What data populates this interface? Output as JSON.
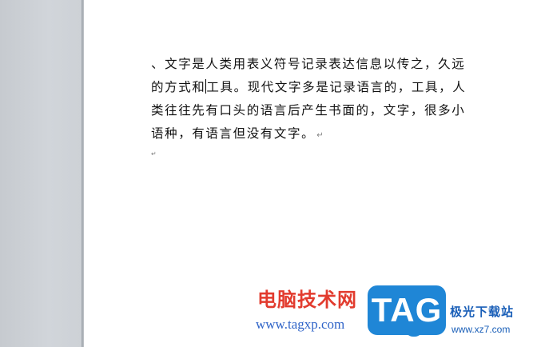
{
  "document": {
    "lines": [
      "、文字是人类用表义符号记录表达信息以传之，久远",
      "工具。现代文字多是记录语言的，工具，人",
      "类往往先有口头的语言后产生书面的，文字，很多小",
      "语种，有语言但没有文字。"
    ],
    "line2_before_caret": "的方式和",
    "paragraph_mark": "↵",
    "empty_paragraph_mark": "↵"
  },
  "watermark": {
    "brand_cn": "电脑技术网",
    "brand_url": "www.tagxp.com",
    "tag_logo": "TAG",
    "site_cn": "极光下载站",
    "site_url": "www.xz7.com"
  },
  "colors": {
    "page_background": "#ffffff",
    "workspace_background": "#d3d7dc",
    "brand_red": "#e23b2e",
    "brand_blue": "#2f64c8",
    "tag_blue": "#1f86d6",
    "site_blue": "#1a5fb8"
  }
}
